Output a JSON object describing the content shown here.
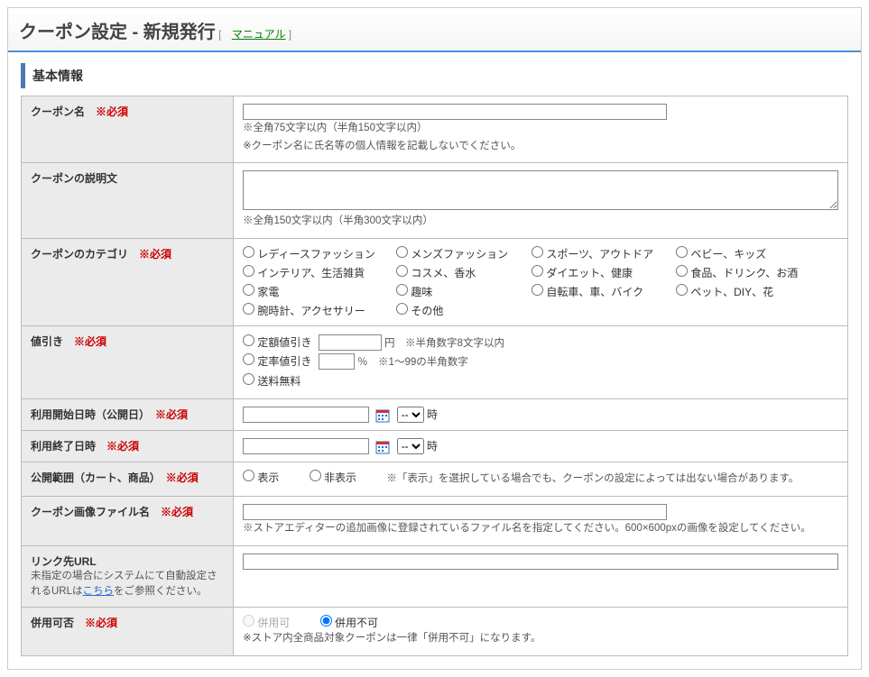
{
  "header": {
    "title": "クーポン設定 - 新規発行",
    "manual": "マニュアル",
    "lbracket": "[",
    "rbracket": "]"
  },
  "section": {
    "basic": "基本情報"
  },
  "labels": {
    "coupon_name": "クーポン名",
    "coupon_desc": "クーポンの説明文",
    "category": "クーポンのカテゴリ",
    "discount": "値引き",
    "start_date": "利用開始日時（公開日）",
    "end_date": "利用終了日時",
    "visibility": "公開範囲（カート、商品）",
    "image_file": "クーポン画像ファイル名",
    "link_url": "リンク先URL",
    "combine": "併用可否",
    "required": "※必須"
  },
  "notes": {
    "name1": "※全角75文字以内（半角150文字以内）",
    "name2": "※クーポン名に氏名等の個人情報を記載しないでください。",
    "desc1": "※全角150文字以内（半角300文字以内）",
    "disc_fixed": "定額値引き",
    "disc_fixed_suffix": "円　※半角数字8文字以内",
    "disc_rate": "定率値引き",
    "disc_rate_suffix": "％　※1～99の半角数字",
    "disc_ship": "送料無料",
    "hour": "時",
    "vis_show": "表示",
    "vis_hide": "非表示",
    "vis_note": "※「表示」を選択している場合でも、クーポンの設定によっては出ない場合があります。",
    "image_note": "※ストアエディターの追加画像に登録されているファイル名を指定してください。600×600pxの画像を設定してください。",
    "link_sub1": "未指定の場合にシステムにて自動設定されるURLは",
    "link_sub2": "こちら",
    "link_sub3": "をご参照ください。",
    "combine_yes": "併用可",
    "combine_no": "併用不可",
    "combine_note": "※ストア内全商品対象クーポンは一律「併用不可」になります。",
    "hour_default": "--"
  },
  "categories": [
    "レディースファッション",
    "メンズファッション",
    "スポーツ、アウトドア",
    "ベビー、キッズ",
    "インテリア、生活雑貨",
    "コスメ、香水",
    "ダイエット、健康",
    "食品、ドリンク、お酒",
    "家電",
    "趣味",
    "自転車、車、バイク",
    "ペット、DIY、花",
    "腕時計、アクセサリー",
    "その他"
  ]
}
